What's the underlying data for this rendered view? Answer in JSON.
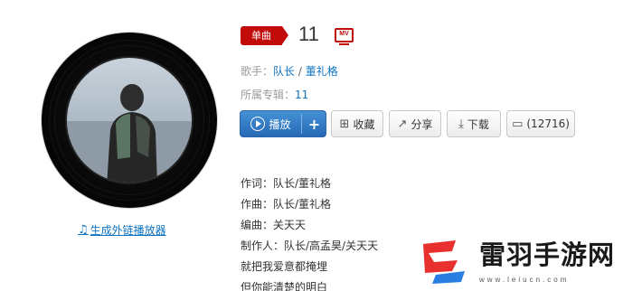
{
  "song": {
    "badge_label": "单曲",
    "title": "11",
    "mv_label": "MV"
  },
  "meta": {
    "singer_label": "歌手：",
    "singer_1": "队长",
    "singer_sep": " / ",
    "singer_2": "董礼格",
    "album_label": "所属专辑：",
    "album": "11"
  },
  "actions": {
    "play_label": "播放",
    "add_label": "+",
    "collect_label": "收藏",
    "share_label": "分享",
    "download_label": "下载",
    "comment_label": "(12716)"
  },
  "embed": {
    "label": "生成外链播放器"
  },
  "lyrics": [
    "作词：队长/董礼格",
    "作曲：队长/董礼格",
    "编曲：关天天",
    "制作人：队长/高孟昊/关天天",
    "就把我爱意都掩埋",
    "但你能清楚的明白"
  ],
  "watermark": {
    "text": "雷羽手游网",
    "url": "www.leiucn.com"
  },
  "colors": {
    "accent_red": "#c20c0c",
    "link_blue": "#0c73c2",
    "play_blue": "#2668b5"
  }
}
